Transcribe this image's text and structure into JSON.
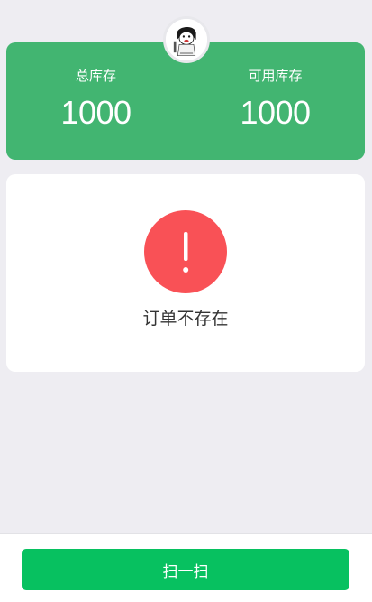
{
  "colors": {
    "page_background": "#eeedf2",
    "stock_card": "#42b571",
    "warning": "#f95156",
    "primary_button": "#07c160"
  },
  "header": {
    "avatar_icon": "avatar-cartoon-icon"
  },
  "stock": {
    "total_label": "总库存",
    "total_value": "1000",
    "available_label": "可用库存",
    "available_value": "1000"
  },
  "result": {
    "icon": "exclamation-icon",
    "message": "订单不存在"
  },
  "footer": {
    "scan_button_label": "扫一扫"
  }
}
